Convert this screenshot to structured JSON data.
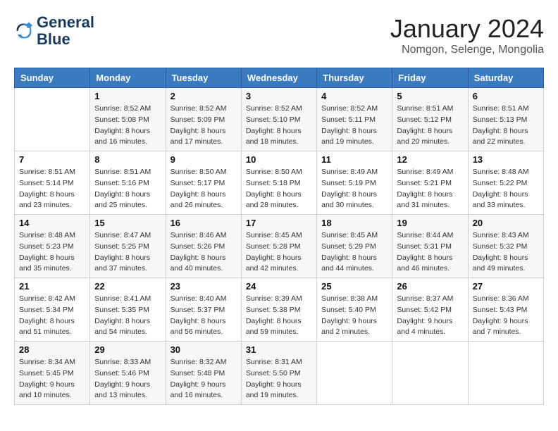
{
  "header": {
    "logo_line1": "General",
    "logo_line2": "Blue",
    "month_title": "January 2024",
    "location": "Nomgon, Selenge, Mongolia"
  },
  "weekdays": [
    "Sunday",
    "Monday",
    "Tuesday",
    "Wednesday",
    "Thursday",
    "Friday",
    "Saturday"
  ],
  "weeks": [
    [
      {
        "day": "",
        "sunrise": "",
        "sunset": "",
        "daylight": ""
      },
      {
        "day": "1",
        "sunrise": "Sunrise: 8:52 AM",
        "sunset": "Sunset: 5:08 PM",
        "daylight": "Daylight: 8 hours and 16 minutes."
      },
      {
        "day": "2",
        "sunrise": "Sunrise: 8:52 AM",
        "sunset": "Sunset: 5:09 PM",
        "daylight": "Daylight: 8 hours and 17 minutes."
      },
      {
        "day": "3",
        "sunrise": "Sunrise: 8:52 AM",
        "sunset": "Sunset: 5:10 PM",
        "daylight": "Daylight: 8 hours and 18 minutes."
      },
      {
        "day": "4",
        "sunrise": "Sunrise: 8:52 AM",
        "sunset": "Sunset: 5:11 PM",
        "daylight": "Daylight: 8 hours and 19 minutes."
      },
      {
        "day": "5",
        "sunrise": "Sunrise: 8:51 AM",
        "sunset": "Sunset: 5:12 PM",
        "daylight": "Daylight: 8 hours and 20 minutes."
      },
      {
        "day": "6",
        "sunrise": "Sunrise: 8:51 AM",
        "sunset": "Sunset: 5:13 PM",
        "daylight": "Daylight: 8 hours and 22 minutes."
      }
    ],
    [
      {
        "day": "7",
        "sunrise": "Sunrise: 8:51 AM",
        "sunset": "Sunset: 5:14 PM",
        "daylight": "Daylight: 8 hours and 23 minutes."
      },
      {
        "day": "8",
        "sunrise": "Sunrise: 8:51 AM",
        "sunset": "Sunset: 5:16 PM",
        "daylight": "Daylight: 8 hours and 25 minutes."
      },
      {
        "day": "9",
        "sunrise": "Sunrise: 8:50 AM",
        "sunset": "Sunset: 5:17 PM",
        "daylight": "Daylight: 8 hours and 26 minutes."
      },
      {
        "day": "10",
        "sunrise": "Sunrise: 8:50 AM",
        "sunset": "Sunset: 5:18 PM",
        "daylight": "Daylight: 8 hours and 28 minutes."
      },
      {
        "day": "11",
        "sunrise": "Sunrise: 8:49 AM",
        "sunset": "Sunset: 5:19 PM",
        "daylight": "Daylight: 8 hours and 30 minutes."
      },
      {
        "day": "12",
        "sunrise": "Sunrise: 8:49 AM",
        "sunset": "Sunset: 5:21 PM",
        "daylight": "Daylight: 8 hours and 31 minutes."
      },
      {
        "day": "13",
        "sunrise": "Sunrise: 8:48 AM",
        "sunset": "Sunset: 5:22 PM",
        "daylight": "Daylight: 8 hours and 33 minutes."
      }
    ],
    [
      {
        "day": "14",
        "sunrise": "Sunrise: 8:48 AM",
        "sunset": "Sunset: 5:23 PM",
        "daylight": "Daylight: 8 hours and 35 minutes."
      },
      {
        "day": "15",
        "sunrise": "Sunrise: 8:47 AM",
        "sunset": "Sunset: 5:25 PM",
        "daylight": "Daylight: 8 hours and 37 minutes."
      },
      {
        "day": "16",
        "sunrise": "Sunrise: 8:46 AM",
        "sunset": "Sunset: 5:26 PM",
        "daylight": "Daylight: 8 hours and 40 minutes."
      },
      {
        "day": "17",
        "sunrise": "Sunrise: 8:45 AM",
        "sunset": "Sunset: 5:28 PM",
        "daylight": "Daylight: 8 hours and 42 minutes."
      },
      {
        "day": "18",
        "sunrise": "Sunrise: 8:45 AM",
        "sunset": "Sunset: 5:29 PM",
        "daylight": "Daylight: 8 hours and 44 minutes."
      },
      {
        "day": "19",
        "sunrise": "Sunrise: 8:44 AM",
        "sunset": "Sunset: 5:31 PM",
        "daylight": "Daylight: 8 hours and 46 minutes."
      },
      {
        "day": "20",
        "sunrise": "Sunrise: 8:43 AM",
        "sunset": "Sunset: 5:32 PM",
        "daylight": "Daylight: 8 hours and 49 minutes."
      }
    ],
    [
      {
        "day": "21",
        "sunrise": "Sunrise: 8:42 AM",
        "sunset": "Sunset: 5:34 PM",
        "daylight": "Daylight: 8 hours and 51 minutes."
      },
      {
        "day": "22",
        "sunrise": "Sunrise: 8:41 AM",
        "sunset": "Sunset: 5:35 PM",
        "daylight": "Daylight: 8 hours and 54 minutes."
      },
      {
        "day": "23",
        "sunrise": "Sunrise: 8:40 AM",
        "sunset": "Sunset: 5:37 PM",
        "daylight": "Daylight: 8 hours and 56 minutes."
      },
      {
        "day": "24",
        "sunrise": "Sunrise: 8:39 AM",
        "sunset": "Sunset: 5:38 PM",
        "daylight": "Daylight: 8 hours and 59 minutes."
      },
      {
        "day": "25",
        "sunrise": "Sunrise: 8:38 AM",
        "sunset": "Sunset: 5:40 PM",
        "daylight": "Daylight: 9 hours and 2 minutes."
      },
      {
        "day": "26",
        "sunrise": "Sunrise: 8:37 AM",
        "sunset": "Sunset: 5:42 PM",
        "daylight": "Daylight: 9 hours and 4 minutes."
      },
      {
        "day": "27",
        "sunrise": "Sunrise: 8:36 AM",
        "sunset": "Sunset: 5:43 PM",
        "daylight": "Daylight: 9 hours and 7 minutes."
      }
    ],
    [
      {
        "day": "28",
        "sunrise": "Sunrise: 8:34 AM",
        "sunset": "Sunset: 5:45 PM",
        "daylight": "Daylight: 9 hours and 10 minutes."
      },
      {
        "day": "29",
        "sunrise": "Sunrise: 8:33 AM",
        "sunset": "Sunset: 5:46 PM",
        "daylight": "Daylight: 9 hours and 13 minutes."
      },
      {
        "day": "30",
        "sunrise": "Sunrise: 8:32 AM",
        "sunset": "Sunset: 5:48 PM",
        "daylight": "Daylight: 9 hours and 16 minutes."
      },
      {
        "day": "31",
        "sunrise": "Sunrise: 8:31 AM",
        "sunset": "Sunset: 5:50 PM",
        "daylight": "Daylight: 9 hours and 19 minutes."
      },
      {
        "day": "",
        "sunrise": "",
        "sunset": "",
        "daylight": ""
      },
      {
        "day": "",
        "sunrise": "",
        "sunset": "",
        "daylight": ""
      },
      {
        "day": "",
        "sunrise": "",
        "sunset": "",
        "daylight": ""
      }
    ]
  ]
}
